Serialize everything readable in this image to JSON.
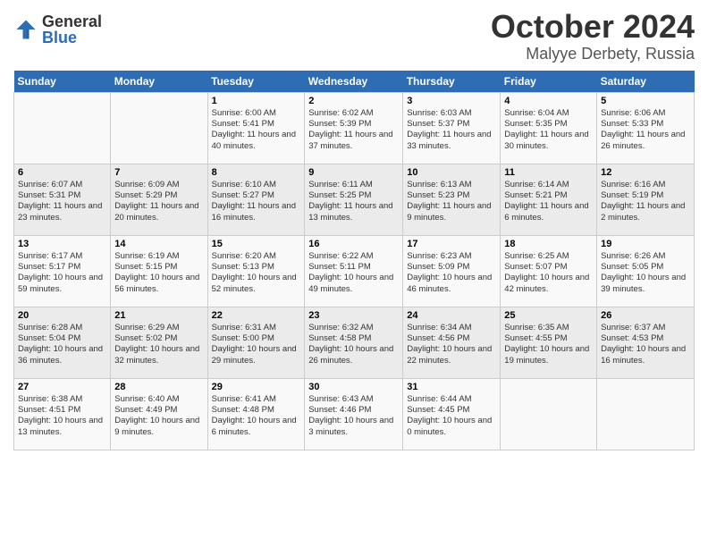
{
  "header": {
    "logo_general": "General",
    "logo_blue": "Blue",
    "month": "October 2024",
    "location": "Malyye Derbety, Russia"
  },
  "days_of_week": [
    "Sunday",
    "Monday",
    "Tuesday",
    "Wednesday",
    "Thursday",
    "Friday",
    "Saturday"
  ],
  "weeks": [
    [
      {
        "day": "",
        "info": ""
      },
      {
        "day": "",
        "info": ""
      },
      {
        "day": "1",
        "info": "Sunrise: 6:00 AM\nSunset: 5:41 PM\nDaylight: 11 hours and 40 minutes."
      },
      {
        "day": "2",
        "info": "Sunrise: 6:02 AM\nSunset: 5:39 PM\nDaylight: 11 hours and 37 minutes."
      },
      {
        "day": "3",
        "info": "Sunrise: 6:03 AM\nSunset: 5:37 PM\nDaylight: 11 hours and 33 minutes."
      },
      {
        "day": "4",
        "info": "Sunrise: 6:04 AM\nSunset: 5:35 PM\nDaylight: 11 hours and 30 minutes."
      },
      {
        "day": "5",
        "info": "Sunrise: 6:06 AM\nSunset: 5:33 PM\nDaylight: 11 hours and 26 minutes."
      }
    ],
    [
      {
        "day": "6",
        "info": "Sunrise: 6:07 AM\nSunset: 5:31 PM\nDaylight: 11 hours and 23 minutes."
      },
      {
        "day": "7",
        "info": "Sunrise: 6:09 AM\nSunset: 5:29 PM\nDaylight: 11 hours and 20 minutes."
      },
      {
        "day": "8",
        "info": "Sunrise: 6:10 AM\nSunset: 5:27 PM\nDaylight: 11 hours and 16 minutes."
      },
      {
        "day": "9",
        "info": "Sunrise: 6:11 AM\nSunset: 5:25 PM\nDaylight: 11 hours and 13 minutes."
      },
      {
        "day": "10",
        "info": "Sunrise: 6:13 AM\nSunset: 5:23 PM\nDaylight: 11 hours and 9 minutes."
      },
      {
        "day": "11",
        "info": "Sunrise: 6:14 AM\nSunset: 5:21 PM\nDaylight: 11 hours and 6 minutes."
      },
      {
        "day": "12",
        "info": "Sunrise: 6:16 AM\nSunset: 5:19 PM\nDaylight: 11 hours and 2 minutes."
      }
    ],
    [
      {
        "day": "13",
        "info": "Sunrise: 6:17 AM\nSunset: 5:17 PM\nDaylight: 10 hours and 59 minutes."
      },
      {
        "day": "14",
        "info": "Sunrise: 6:19 AM\nSunset: 5:15 PM\nDaylight: 10 hours and 56 minutes."
      },
      {
        "day": "15",
        "info": "Sunrise: 6:20 AM\nSunset: 5:13 PM\nDaylight: 10 hours and 52 minutes."
      },
      {
        "day": "16",
        "info": "Sunrise: 6:22 AM\nSunset: 5:11 PM\nDaylight: 10 hours and 49 minutes."
      },
      {
        "day": "17",
        "info": "Sunrise: 6:23 AM\nSunset: 5:09 PM\nDaylight: 10 hours and 46 minutes."
      },
      {
        "day": "18",
        "info": "Sunrise: 6:25 AM\nSunset: 5:07 PM\nDaylight: 10 hours and 42 minutes."
      },
      {
        "day": "19",
        "info": "Sunrise: 6:26 AM\nSunset: 5:05 PM\nDaylight: 10 hours and 39 minutes."
      }
    ],
    [
      {
        "day": "20",
        "info": "Sunrise: 6:28 AM\nSunset: 5:04 PM\nDaylight: 10 hours and 36 minutes."
      },
      {
        "day": "21",
        "info": "Sunrise: 6:29 AM\nSunset: 5:02 PM\nDaylight: 10 hours and 32 minutes."
      },
      {
        "day": "22",
        "info": "Sunrise: 6:31 AM\nSunset: 5:00 PM\nDaylight: 10 hours and 29 minutes."
      },
      {
        "day": "23",
        "info": "Sunrise: 6:32 AM\nSunset: 4:58 PM\nDaylight: 10 hours and 26 minutes."
      },
      {
        "day": "24",
        "info": "Sunrise: 6:34 AM\nSunset: 4:56 PM\nDaylight: 10 hours and 22 minutes."
      },
      {
        "day": "25",
        "info": "Sunrise: 6:35 AM\nSunset: 4:55 PM\nDaylight: 10 hours and 19 minutes."
      },
      {
        "day": "26",
        "info": "Sunrise: 6:37 AM\nSunset: 4:53 PM\nDaylight: 10 hours and 16 minutes."
      }
    ],
    [
      {
        "day": "27",
        "info": "Sunrise: 6:38 AM\nSunset: 4:51 PM\nDaylight: 10 hours and 13 minutes."
      },
      {
        "day": "28",
        "info": "Sunrise: 6:40 AM\nSunset: 4:49 PM\nDaylight: 10 hours and 9 minutes."
      },
      {
        "day": "29",
        "info": "Sunrise: 6:41 AM\nSunset: 4:48 PM\nDaylight: 10 hours and 6 minutes."
      },
      {
        "day": "30",
        "info": "Sunrise: 6:43 AM\nSunset: 4:46 PM\nDaylight: 10 hours and 3 minutes."
      },
      {
        "day": "31",
        "info": "Sunrise: 6:44 AM\nSunset: 4:45 PM\nDaylight: 10 hours and 0 minutes."
      },
      {
        "day": "",
        "info": ""
      },
      {
        "day": "",
        "info": ""
      }
    ]
  ]
}
